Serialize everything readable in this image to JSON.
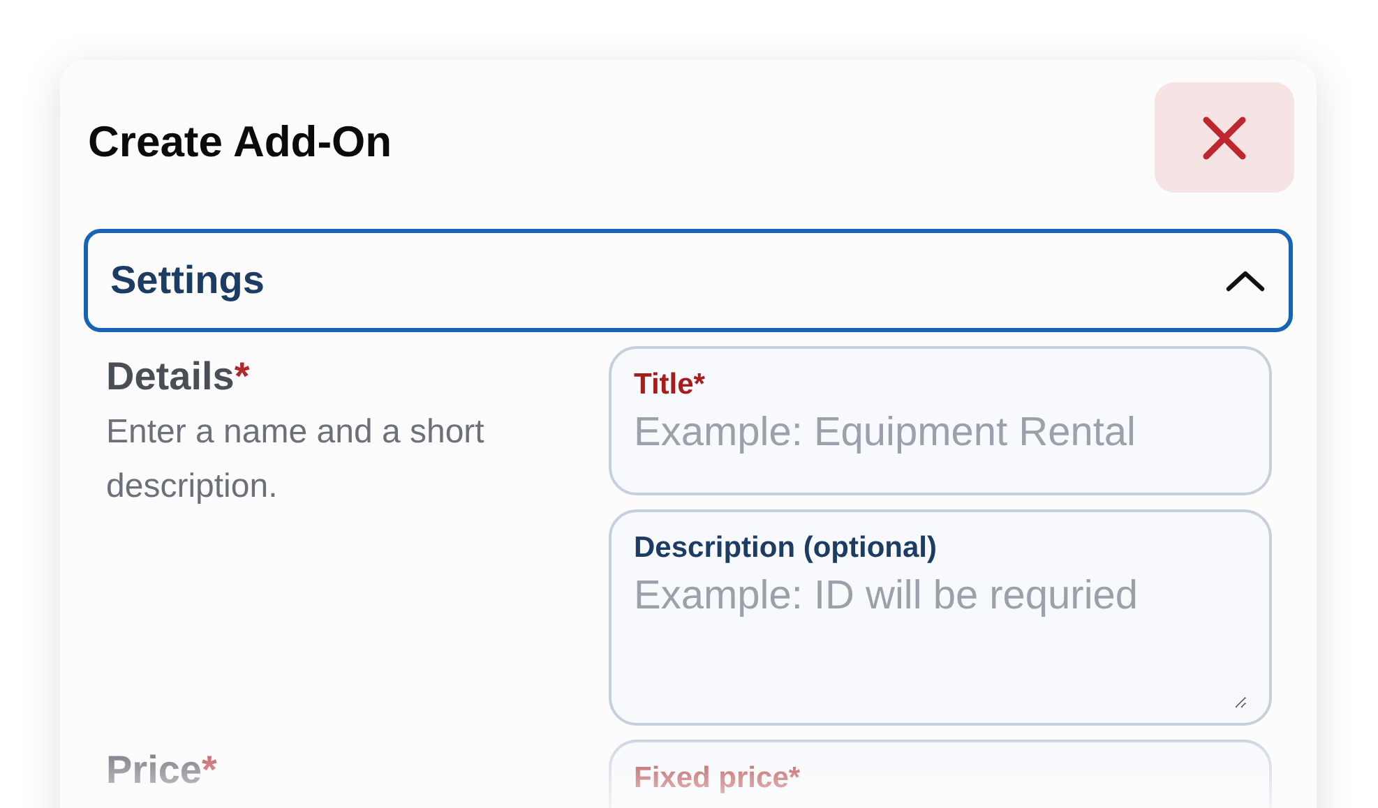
{
  "dialog": {
    "title": "Create Add-On"
  },
  "accordion": {
    "label": "Settings",
    "expanded": true
  },
  "sections": [
    {
      "title": "Details",
      "mark": "*",
      "description": "Enter a name and a short description.",
      "fields": [
        {
          "kind": "input",
          "label": "Title*",
          "required": true,
          "placeholder": "Example: Equipment Rental"
        },
        {
          "kind": "textarea",
          "label": "Description (optional)",
          "required": false,
          "placeholder": "Example: ID will be requried"
        }
      ]
    },
    {
      "title": "Price",
      "mark": "*",
      "fields": [
        {
          "kind": "input",
          "label": "Fixed price*",
          "required": true
        }
      ]
    }
  ]
}
